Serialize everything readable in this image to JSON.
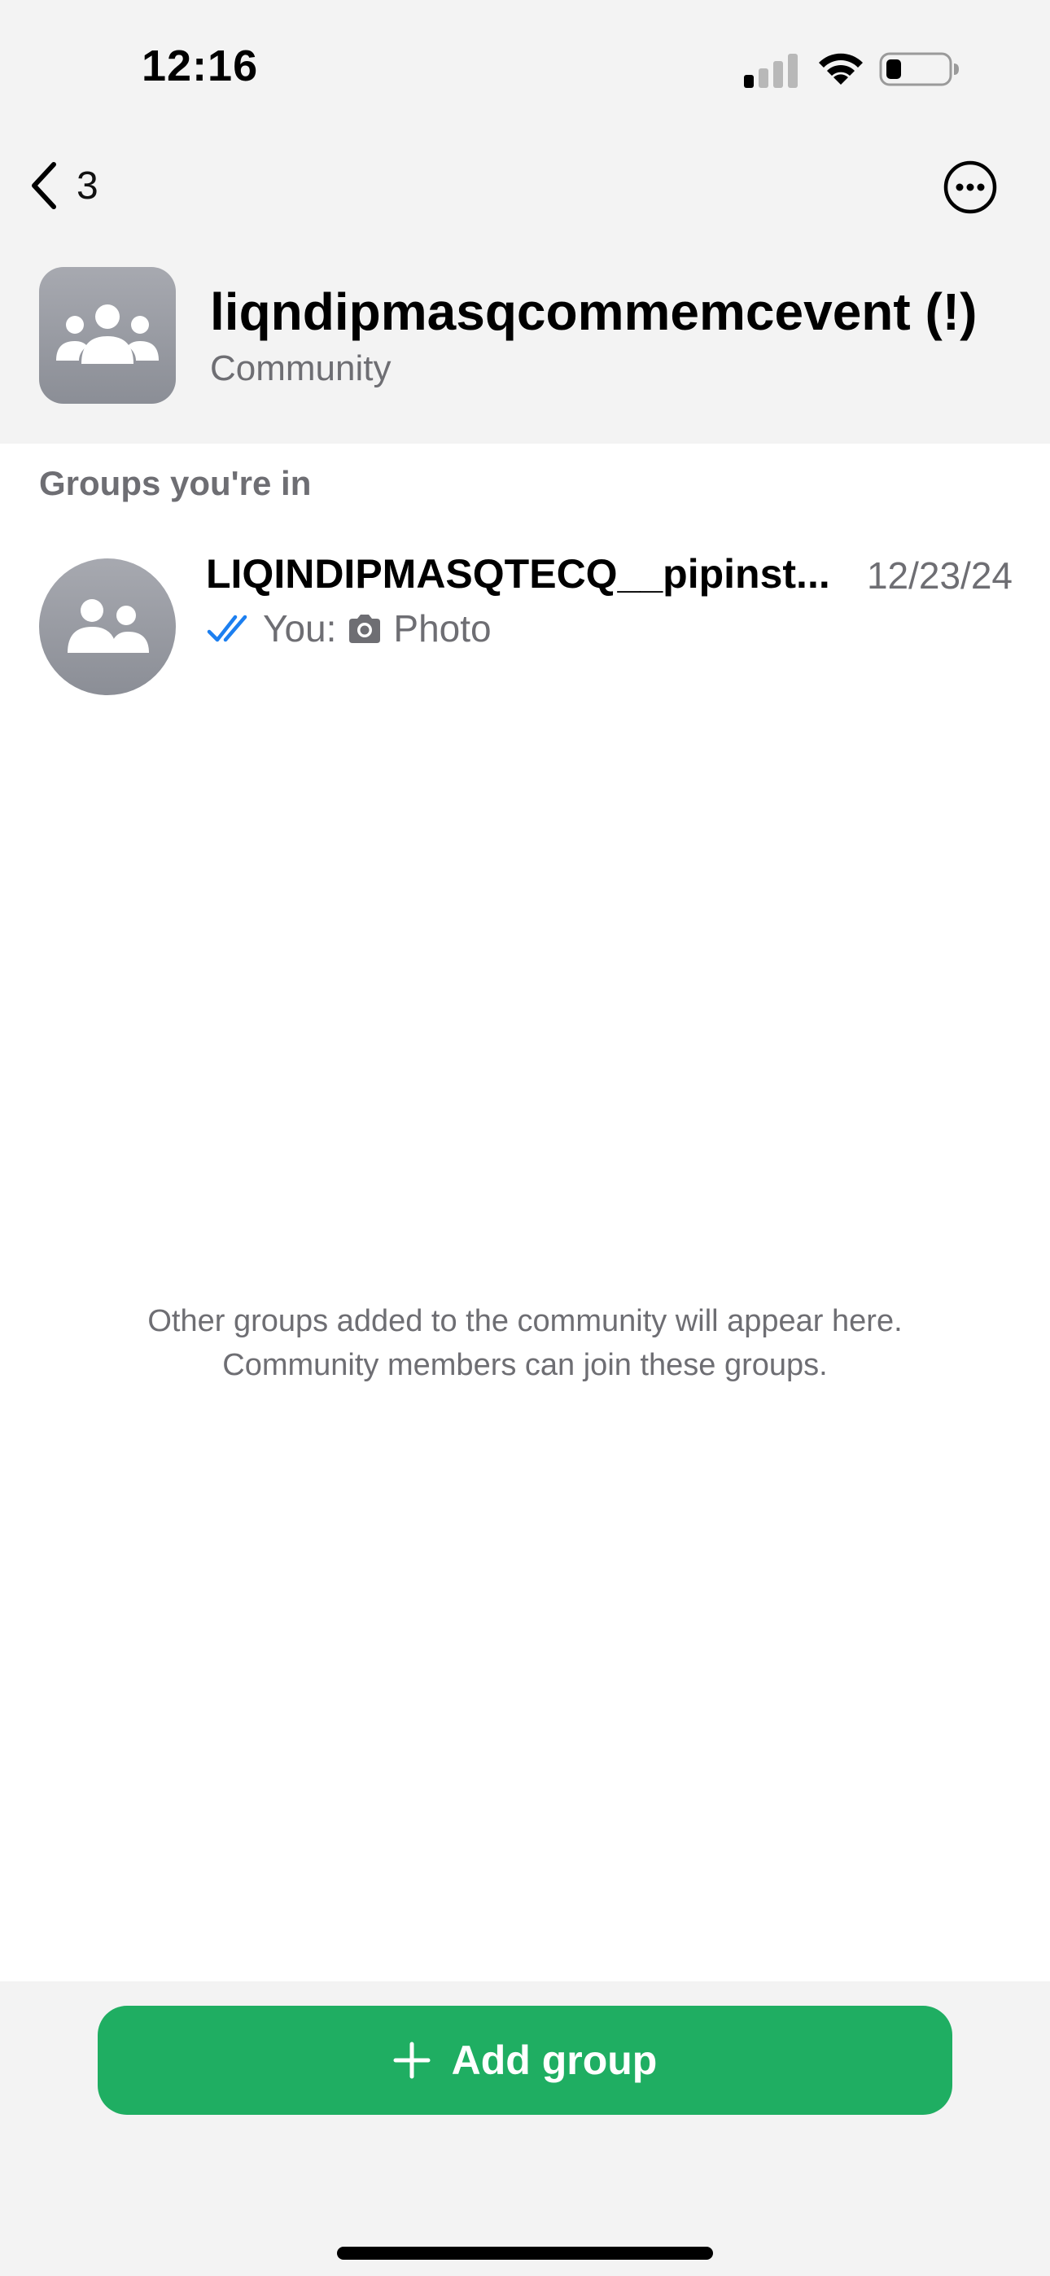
{
  "status_bar": {
    "time": "12:16"
  },
  "nav": {
    "back_count": "3"
  },
  "community": {
    "title": "liqndipmasqcommemcevent (!)",
    "subtitle": "Community"
  },
  "groups_section": {
    "header": "Groups you're in",
    "items": [
      {
        "name": "LIQINDIPMASQTECQ__pipinst...",
        "date": "12/23/24",
        "sender": "You:",
        "preview": "Photo"
      }
    ]
  },
  "empty_message": {
    "line1": "Other groups added to the community will appear here.",
    "line2": "Community members can join these groups."
  },
  "footer": {
    "add_group_label": "Add group"
  },
  "colors": {
    "accent_green": "#1fae62",
    "read_check_blue": "#1c7ff0",
    "avatar_gray": "#989ba2"
  }
}
